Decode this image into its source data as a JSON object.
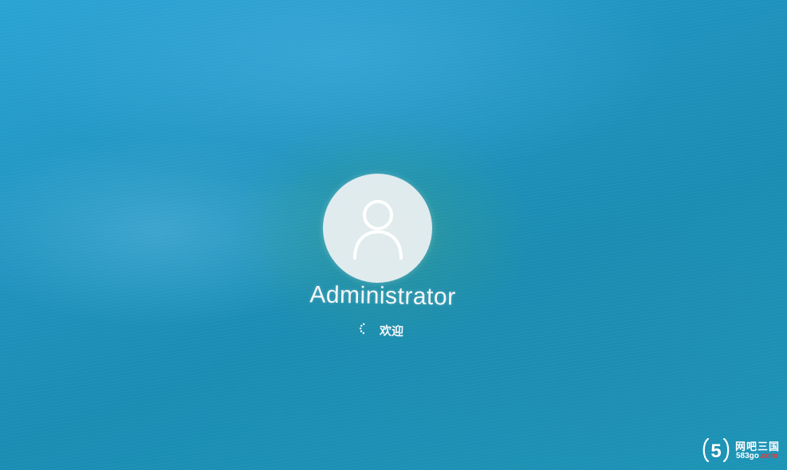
{
  "login": {
    "username": "Administrator",
    "status_text": "欢迎",
    "avatar_icon": "user-silhouette-icon",
    "spinner_icon": "loading-spinner-icon"
  },
  "watermark": {
    "logo_glyph": "5",
    "name": "网吧三国",
    "domain_main": "583go",
    "domain_suffix": ".com"
  },
  "colors": {
    "background": "#1f8fb5",
    "avatar_bg": "#eff1f3",
    "text": "#f4f7f8",
    "watermark_accent": "#e33b3b"
  }
}
